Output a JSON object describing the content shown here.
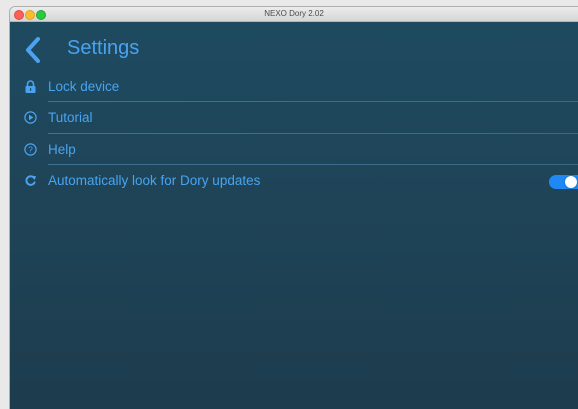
{
  "window": {
    "title": "NEXO Dory 2.02"
  },
  "header": {
    "title": "Settings",
    "back_icon": "chevron-left-icon"
  },
  "settings": [
    {
      "id": "lock",
      "label": "Lock device",
      "icon": "lock-icon"
    },
    {
      "id": "tutorial",
      "label": "Tutorial",
      "icon": "play-circle-icon"
    },
    {
      "id": "help",
      "label": "Help",
      "icon": "help-circle-icon"
    },
    {
      "id": "updates",
      "label": "Automatically look for Dory updates",
      "icon": "refresh-icon",
      "toggle_on": true
    }
  ],
  "colors": {
    "accent": "#4aa3f0",
    "toggle_on": "#1e88f5",
    "background_top": "#1e4a60",
    "background_bottom": "#1d3c4e"
  }
}
